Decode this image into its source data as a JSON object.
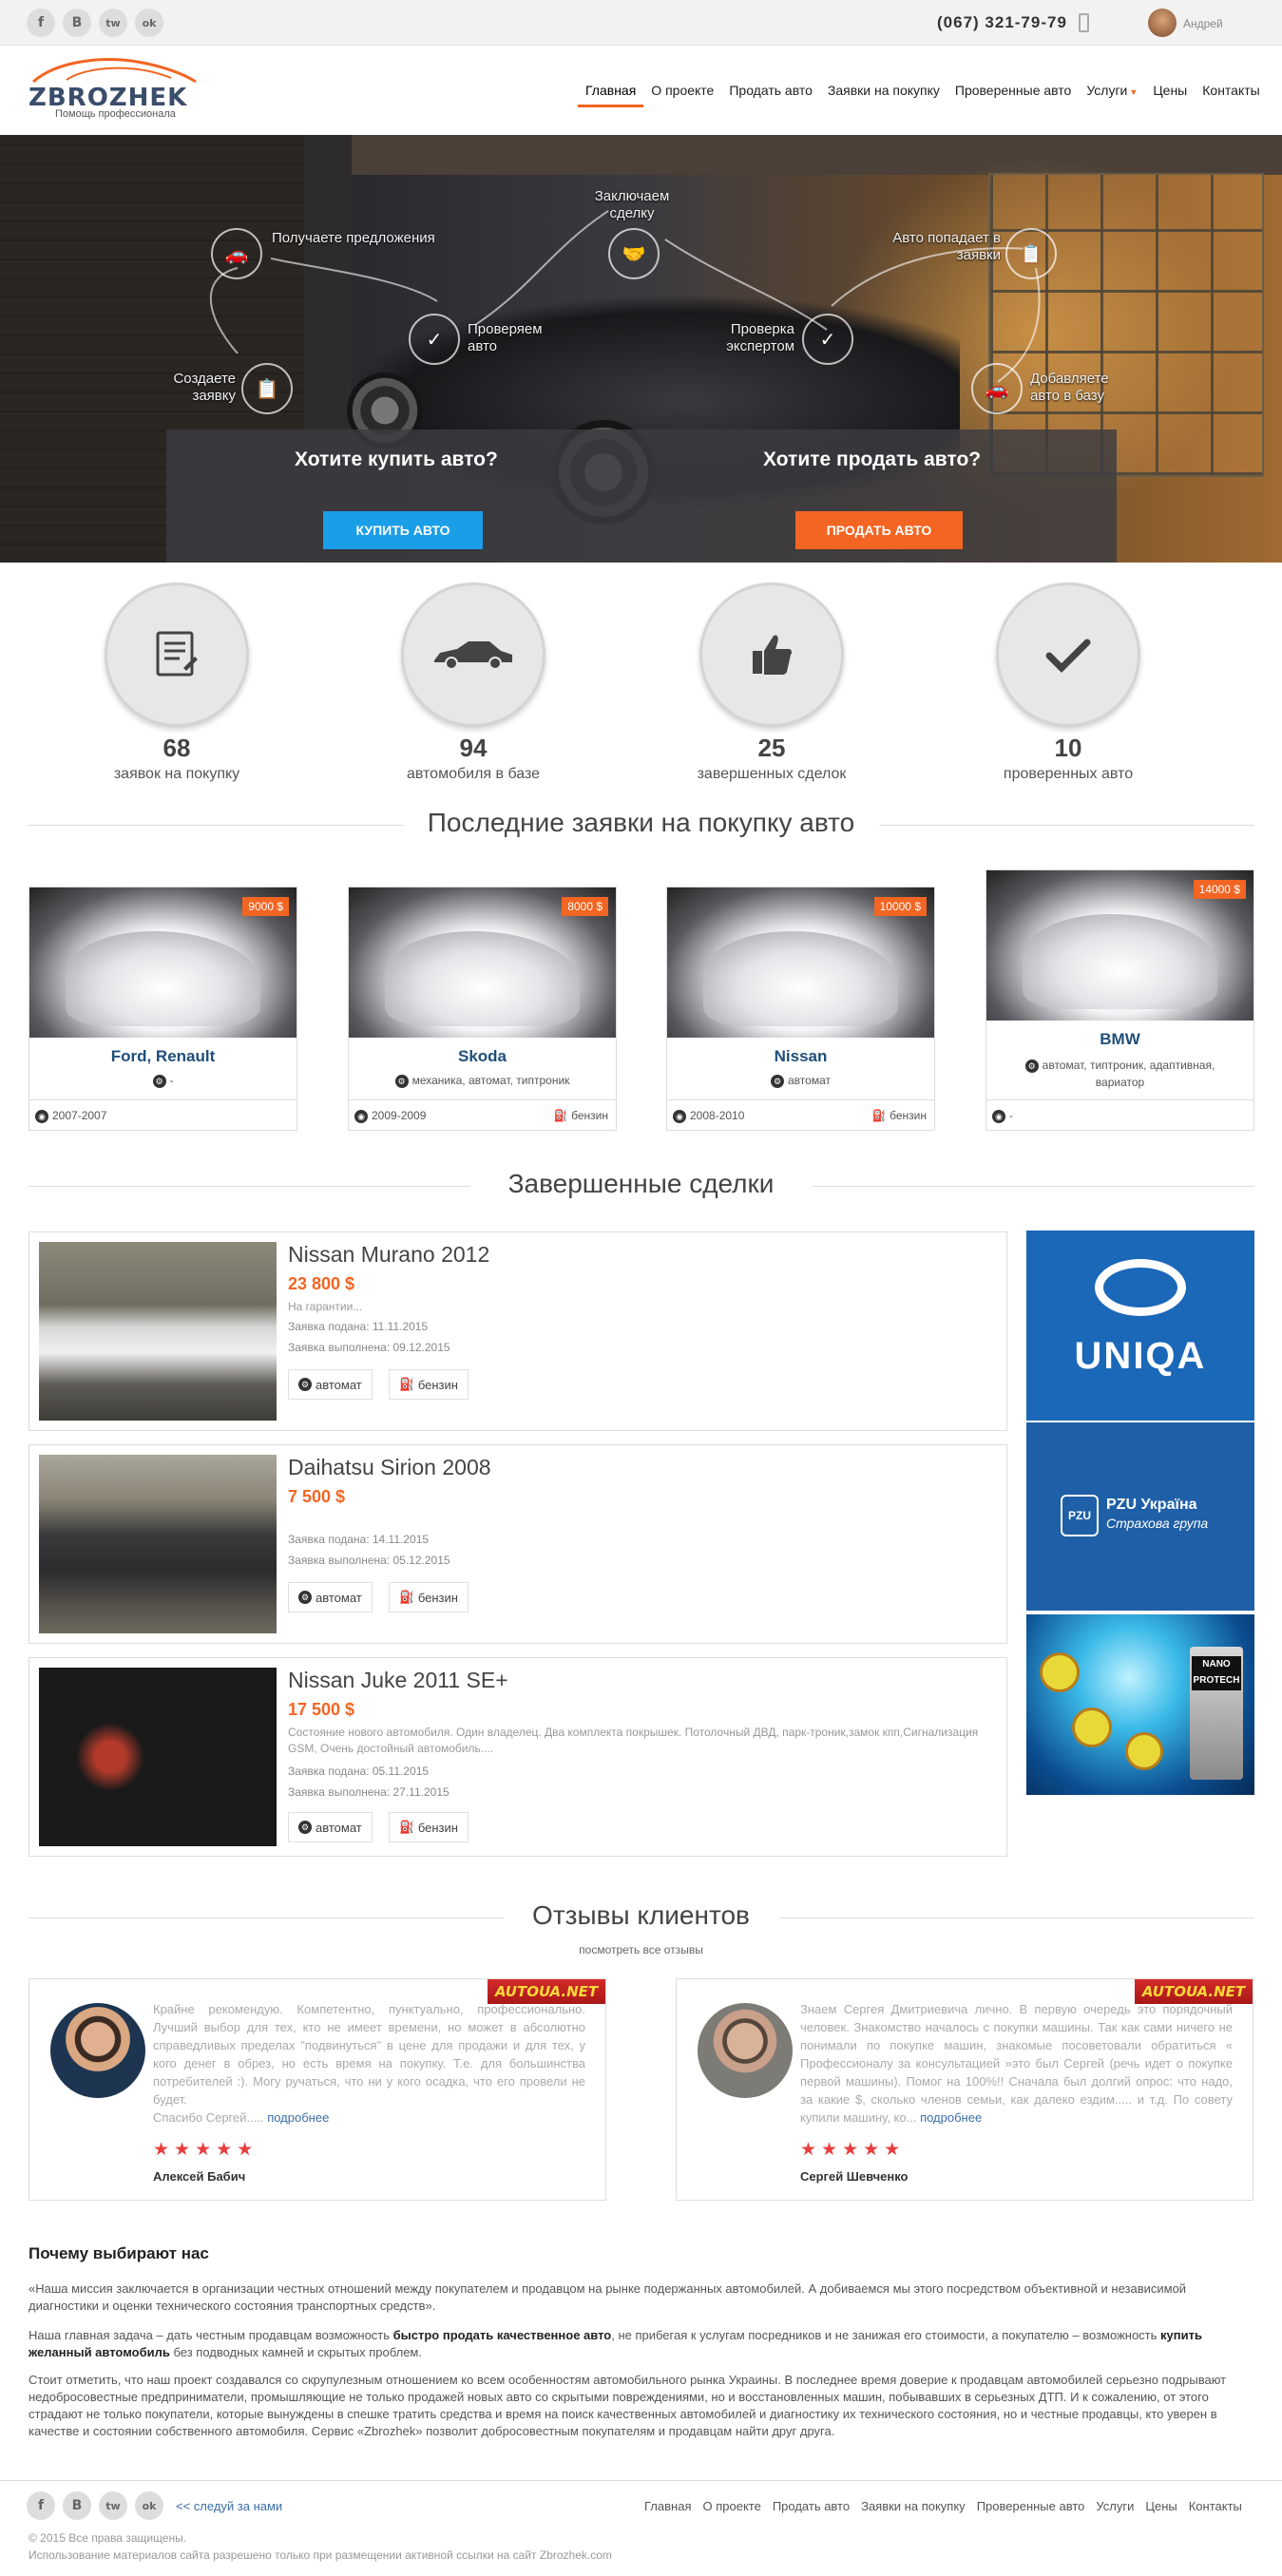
{
  "topbar": {
    "social": [
      "f",
      "B",
      "tw",
      "ok"
    ],
    "phone": "(067) 321-79-79",
    "user": "Андрей"
  },
  "header": {
    "logo": "ZBROZHEK",
    "tagline": "Помощь профессионала",
    "nav": [
      "Главная",
      "О проекте",
      "Продать авто",
      "Заявки на покупку",
      "Проверенные авто",
      "Услуги",
      "Цены",
      "Контакты"
    ],
    "active": "Главная",
    "brand_color": "#f26522"
  },
  "hero": {
    "steps": {
      "offers": "Получаете предложения",
      "deal": "Заключаем сделку",
      "in_requests": "Авто попадает в заявки",
      "check": "Проверяем авто",
      "expert": "Проверка экспертом",
      "create": "Создаете заявку",
      "add": "Добавляете авто в базу"
    },
    "buy_question": "Хотите купить авто?",
    "sell_question": "Хотите продать авто?",
    "buy_button": "КУПИТЬ АВТО",
    "sell_button": "ПРОДАТЬ АВТО",
    "buy_color": "#1a9ee8",
    "sell_color": "#f26522"
  },
  "stats": [
    {
      "num": "68",
      "label": "заявок на покупку",
      "icon": "document-icon"
    },
    {
      "num": "94",
      "label": "автомобиля в базе",
      "icon": "car-icon"
    },
    {
      "num": "25",
      "label": "завершенных сделок",
      "icon": "thumbs-up-icon"
    },
    {
      "num": "10",
      "label": "проверенных авто",
      "icon": "checkmark-icon"
    }
  ],
  "requests": {
    "title": "Последние заявки на покупку авто",
    "cards": [
      {
        "price": "9000 $",
        "title": "Ford, Renault",
        "spec": "-",
        "years": "2007-2007",
        "fuel": ""
      },
      {
        "price": "8000 $",
        "title": "Skoda",
        "spec": "механика, автомат, типтроник",
        "years": "2009-2009",
        "fuel": "бензин"
      },
      {
        "price": "10000 $",
        "title": "Nissan",
        "spec": "автомат",
        "years": "2008-2010",
        "fuel": "бензин"
      },
      {
        "price": "14000 $",
        "title": "BMW",
        "spec": "автомат, типтроник, адаптивная, вариатор",
        "years": "-",
        "fuel": ""
      }
    ]
  },
  "deals": {
    "title": "Завершенные сделки",
    "items": [
      {
        "title": "Nissan Murano 2012",
        "price": "23 800 $",
        "desc": "На гарантии...",
        "submitted": "Заявка подана: 11.11.2015",
        "done": "Заявка выполнена: 09.12.2015",
        "gear": "автомат",
        "fuel": "бензин"
      },
      {
        "title": "Daihatsu Sirion 2008",
        "price": "7 500 $",
        "desc": "",
        "submitted": "Заявка подана: 14.11.2015",
        "done": "Заявка выполнена: 05.12.2015",
        "gear": "автомат",
        "fuel": "бензин"
      },
      {
        "title": "Nissan Juke 2011 SE+",
        "price": "17 500 $",
        "desc": "Состояние нового автомобиля. Один владелец. Два комплекта покрышек. Потолочный ДВД, парк-троник,замок кпп,Сигнализация GSM, Очень достойный автомобиль....",
        "submitted": "Заявка подана: 05.11.2015",
        "done": "Заявка выполнена: 27.11.2015",
        "gear": "автомат",
        "fuel": "бензин"
      }
    ]
  },
  "ads": {
    "uniqa": "UNIQA",
    "pzu_line1": "PZU Україна",
    "pzu_line2": "Страхова група",
    "nano_line1": "NANO",
    "nano_line2": "PROTECH"
  },
  "reviews": {
    "title": "Отзывы клиентов",
    "see_all": "посмотреть все отзывы",
    "badge": "AUTOUA.NET",
    "items": [
      {
        "text": "Крайне рекомендую. Компетентно, пунктуально, профессионально. Лучший выбор для тех, кто не имеет времени, но может в абсолютно справедливых пределах \"подвинуться\" в цене для продажи и для тех, у кого денег в обрез, но есть время на покупку. Т.е. для большинства потребителей :). Могу ручаться, что ни у кого осадка, что его провели не будет.\nСпасибо Сергей.....",
        "more": "подробнее",
        "stars": "★★★★★",
        "name": "Алексей Бабич"
      },
      {
        "text": "Знаем Сергея Дмитриевича лично. В первую очередь это порядочный человек. Знакомство началось с покупки машины. Так как сами ничего не понимали по покупке машин, знакомые посоветовали обратиться « Профессионалу за консультацией »это был Сергей (речь идет о покупке первой машины). Помог на 100%!! Сначала был долгий опрос: что надо, за какие $, сколько членов семьи, как далеко ездим..... и т.д. По совету купили машину, ко...",
        "more": "подробнее",
        "stars": "★★★★★",
        "name": "Сергей Шевченко"
      }
    ]
  },
  "about": {
    "title": "Почему выбирают нас",
    "p1": "«Наша миссия заключается в организации честных отношений между покупателем и продавцом на рынке подержанных автомобилей. А добиваемся мы этого посредством объективной и независимой диагностики и оценки технического состояния транспортных средств».",
    "p2_a": "Наша главная задача – дать честным продавцам возможность ",
    "p2_b": "быстро продать качественное авто",
    "p2_c": ", не прибегая к услугам посредников и не занижая его стоимости, а покупателю – возможность ",
    "p2_d": "купить желанный автомобиль",
    "p2_e": " без подводных камней и скрытых проблем.",
    "p3": "Стоит отметить, что наш проект создавался со скрупулезным отношением ко всем особенностям автомобильного рынка Украины. В последнее время доверие к продавцам автомобилей серьезно подрывают недобросовестные предприниматели, промышляющие не только продажей новых авто со скрытыми повреждениями, но и восстановленных машин, побывавших в серьезных ДТП. И к сожалению, от этого страдают не только покупатели, которые вынуждены в спешке тратить средства и время на поиск качественных автомобилей и диагностику их технического состояния, но и честные продавцы, кто уверен в качестве и состоянии собственного автомобиля. Сервис «Zbrozhek» позволит добросовестным покупателям и продавцам найти друг друга."
  },
  "footer": {
    "follow": "<< следуй за нами",
    "nav": [
      "Главная",
      "О проекте",
      "Продать авто",
      "Заявки на покупку",
      "Проверенные авто",
      "Услуги",
      "Цены",
      "Контакты"
    ],
    "copyright": "© 2015 Все права защищены.",
    "notice": "Использование материалов сайта разрешено только при размещении активной ссылки на сайт Zbrozhek.com"
  }
}
